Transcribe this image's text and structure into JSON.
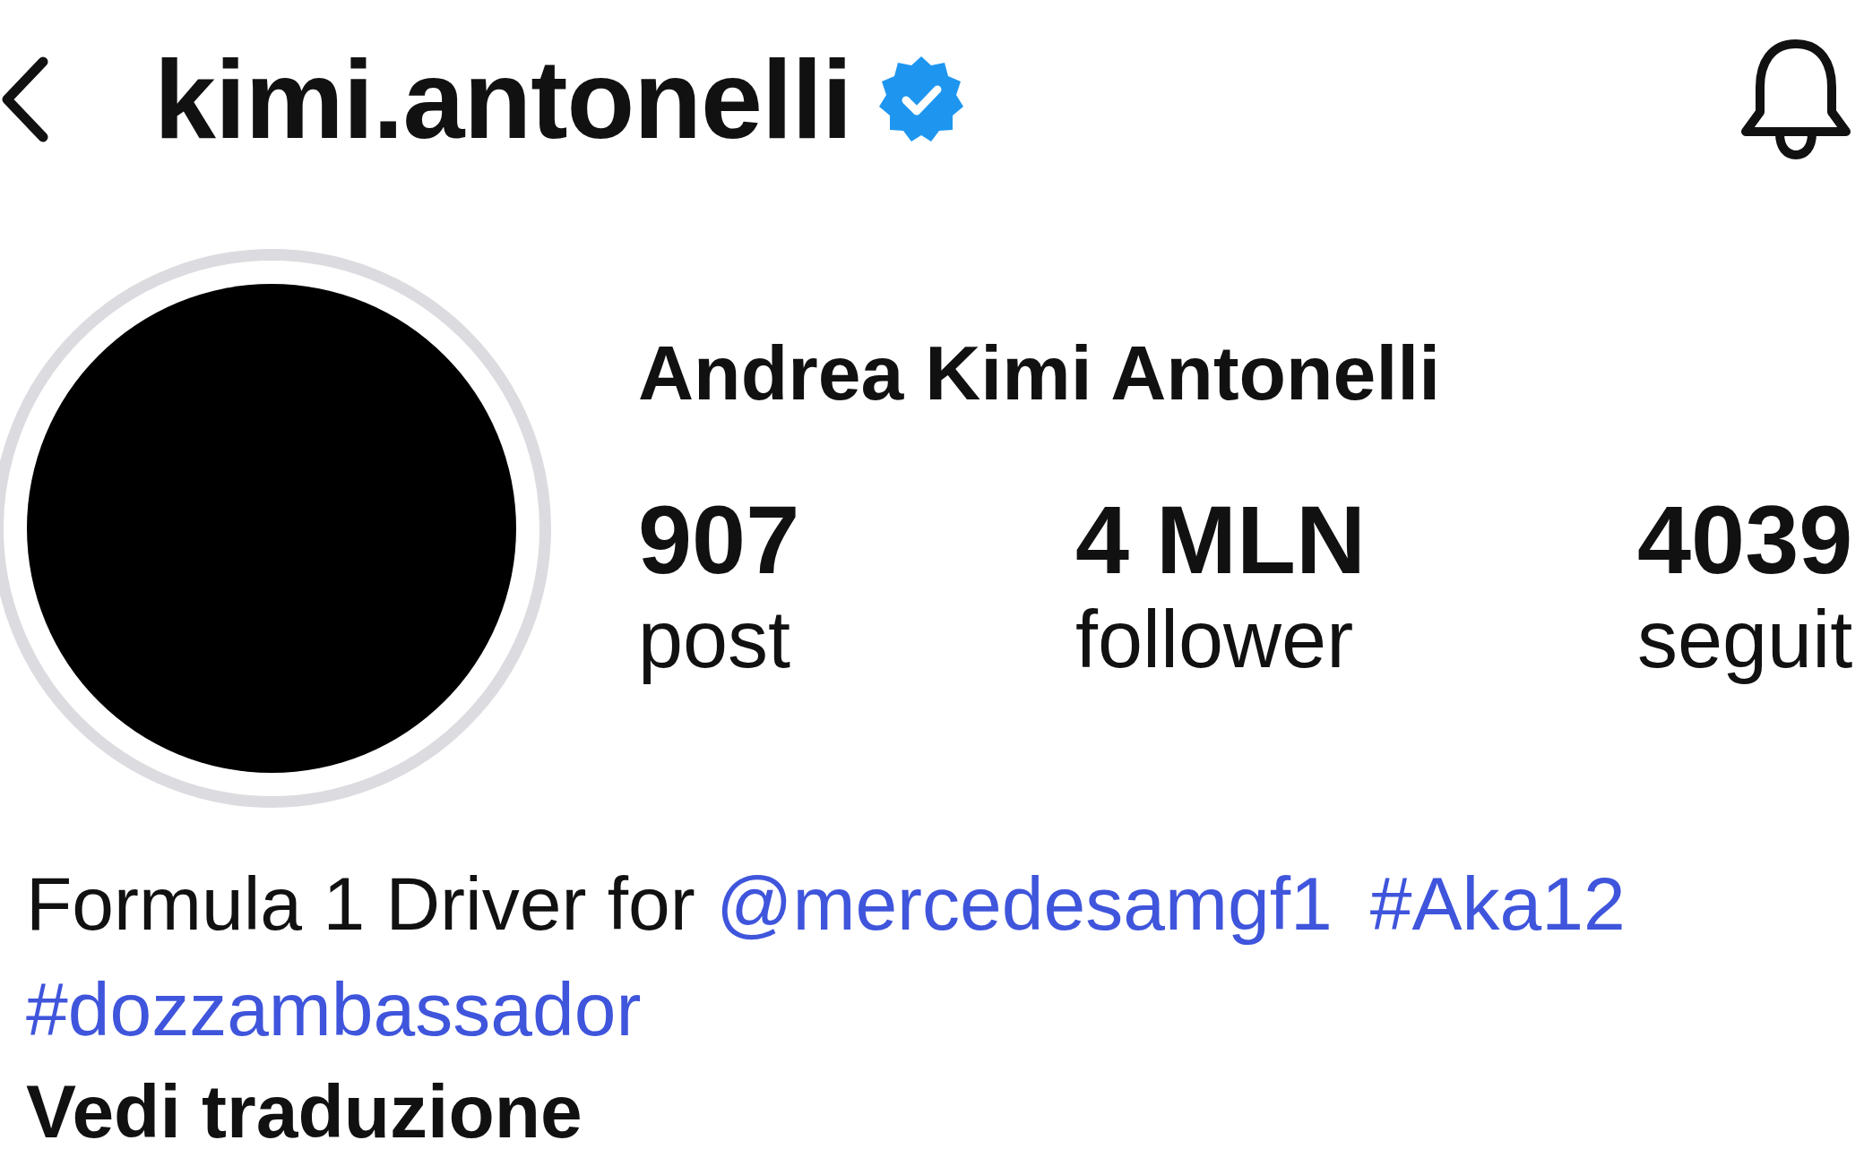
{
  "header": {
    "username": "kimi.antonelli",
    "verified": true
  },
  "profile": {
    "full_name": "Andrea Kimi Antonelli",
    "stats": [
      {
        "value": "907",
        "label": "post"
      },
      {
        "value": "4 MLN",
        "label": "follower"
      },
      {
        "value": "4039",
        "label": "seguit"
      }
    ]
  },
  "bio": [
    {
      "kind": "text",
      "text": "Formula 1 Driver for "
    },
    {
      "kind": "link",
      "text": "@mercedesamgf1"
    },
    {
      "kind": "link",
      "text": "#Aka12"
    },
    {
      "kind": "link",
      "text": "#dozzambassador"
    }
  ],
  "translate_link": "Vedi traduzione"
}
